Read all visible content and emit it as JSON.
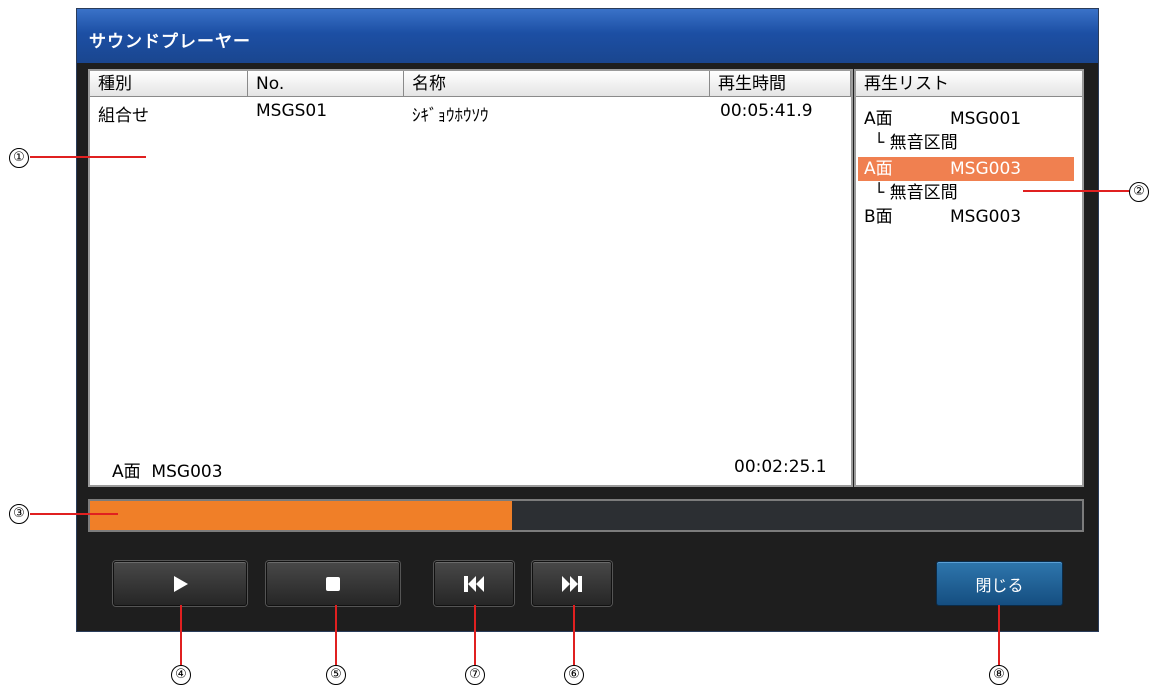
{
  "window": {
    "title": "サウンドプレーヤー"
  },
  "message_list": {
    "columns": [
      "種別",
      "No.",
      "名称",
      "再生時間"
    ],
    "rows": [
      {
        "type": "組合せ",
        "no": "MSGS01",
        "name": "ｼｷﾞｮｳﾎｳｿｳ",
        "time": "00:05:41.9"
      }
    ],
    "now_playing": {
      "label": "A面  MSG003",
      "time": "00:02:25.1"
    }
  },
  "playlist": {
    "header": "再生リスト",
    "items": [
      {
        "side": "A面",
        "message": "MSG001",
        "selected": false
      },
      {
        "sub": "└ 無音区間"
      },
      {
        "side": "A面",
        "message": "MSG003",
        "selected": true
      },
      {
        "sub": "└ 無音区間"
      },
      {
        "side": "B面",
        "message": "MSG003",
        "selected": false
      }
    ]
  },
  "progress": {
    "fraction": 0.425,
    "color": "#f07f28"
  },
  "controls": {
    "play_icon": "play-icon",
    "stop_icon": "stop-icon",
    "prev_icon": "skip-previous-icon",
    "next_icon": "skip-next-icon",
    "close_label": "閉じる"
  },
  "callouts": [
    "①",
    "②",
    "③",
    "④",
    "⑤",
    "⑥",
    "⑦",
    "⑧"
  ],
  "colors": {
    "accent": "#f07f28",
    "selection": "#f08050",
    "lead_line": "#e02020",
    "title_bar": "#1c4fa4"
  }
}
